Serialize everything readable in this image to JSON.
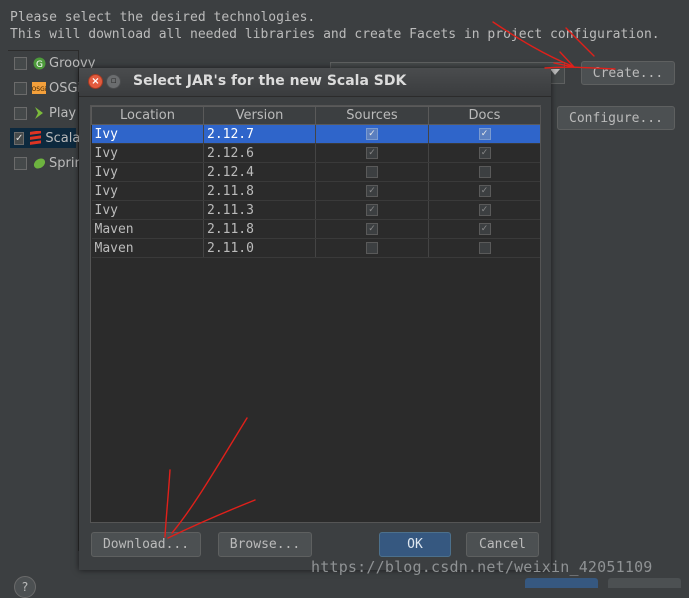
{
  "intro": {
    "line1": "Please select the desired technologies.",
    "line2": "This will download all needed libraries and create Facets in project configuration."
  },
  "technologies": [
    {
      "label": "Groovy",
      "checked": false,
      "icon": "groovy-icon"
    },
    {
      "label": "OSGi",
      "checked": false,
      "icon": "osgi-icon"
    },
    {
      "label": "Play",
      "checked": false,
      "icon": "play-icon"
    },
    {
      "label": "Scala",
      "checked": true,
      "icon": "scala-icon"
    },
    {
      "label": "Spring",
      "checked": false,
      "icon": "spring-icon"
    }
  ],
  "background_buttons": {
    "create": "Create...",
    "configure": "Configure..."
  },
  "dialog": {
    "title": "Select JAR's for the new Scala SDK",
    "columns": [
      "Location",
      "Version",
      "Sources",
      "Docs"
    ],
    "rows": [
      {
        "location": "Ivy",
        "version": "2.12.7",
        "sources": true,
        "docs": true,
        "selected": true
      },
      {
        "location": "Ivy",
        "version": "2.12.6",
        "sources": true,
        "docs": true,
        "selected": false
      },
      {
        "location": "Ivy",
        "version": "2.12.4",
        "sources": false,
        "docs": false,
        "selected": false
      },
      {
        "location": "Ivy",
        "version": "2.11.8",
        "sources": true,
        "docs": true,
        "selected": false
      },
      {
        "location": "Ivy",
        "version": "2.11.3",
        "sources": true,
        "docs": true,
        "selected": false
      },
      {
        "location": "Maven",
        "version": "2.11.8",
        "sources": true,
        "docs": true,
        "selected": false
      },
      {
        "location": "Maven",
        "version": "2.11.0",
        "sources": false,
        "docs": false,
        "selected": false
      }
    ],
    "buttons": {
      "download": "Download...",
      "browse": "Browse...",
      "ok": "OK",
      "cancel": "Cancel"
    }
  },
  "help": "?",
  "watermark": "https://blog.csdn.net/weixin_42051109",
  "colors": {
    "background": "#3c3f41",
    "selection": "#2f65ca",
    "default_button": "#365880",
    "annotation": "#e0201a"
  }
}
